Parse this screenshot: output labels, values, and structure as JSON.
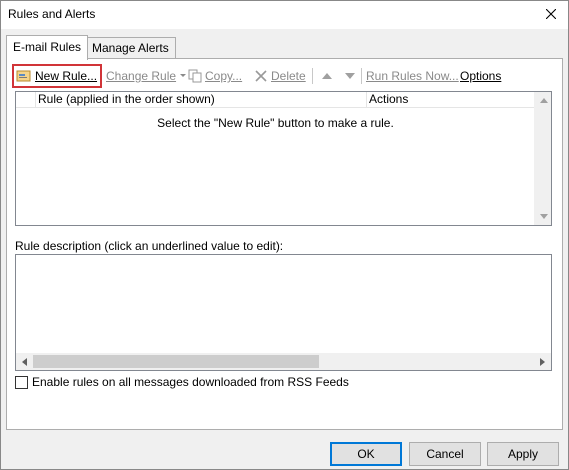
{
  "window": {
    "title": "Rules and Alerts"
  },
  "tabs": [
    {
      "label": "E-mail Rules",
      "active": true
    },
    {
      "label": "Manage Alerts",
      "active": false
    }
  ],
  "toolbar": {
    "new_rule": "New Rule...",
    "change_rule": "Change Rule",
    "copy": "Copy...",
    "delete": "Delete",
    "run_rules_now": "Run Rules Now...",
    "options": "Options"
  },
  "rules_list": {
    "columns": [
      "Rule (applied in the order shown)",
      "Actions"
    ],
    "empty_message": "Select the \"New Rule\" button to make a rule."
  },
  "description": {
    "label": "Rule description (click an underlined value to edit):"
  },
  "rss": {
    "label": "Enable rules on all messages downloaded from RSS Feeds",
    "checked": false
  },
  "buttons": {
    "ok": "OK",
    "cancel": "Cancel",
    "apply": "Apply"
  },
  "colors": {
    "highlight": "#d13438",
    "default_button": "#0078d7"
  }
}
